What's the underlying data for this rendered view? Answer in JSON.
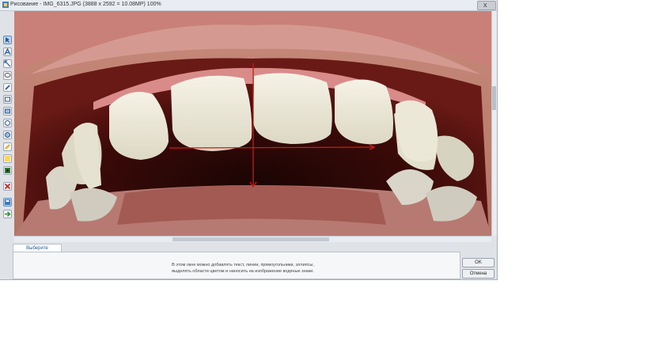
{
  "window": {
    "title": "Рисование - IMG_6315.JPG (3888 x 2592 = 10.08MP) 100%",
    "close_label": "x"
  },
  "toolbar": {
    "tools": [
      {
        "name": "select-tool",
        "icon": "cursor-icon",
        "selected": true
      },
      {
        "name": "text-tool",
        "icon": "text-a-icon"
      },
      {
        "name": "arrow-tool",
        "icon": "arrow-icon"
      },
      {
        "name": "lasso-tool",
        "icon": "lasso-icon"
      },
      {
        "name": "pen-tool",
        "icon": "pen-icon"
      },
      {
        "name": "rectangle-tool",
        "icon": "rectangle-icon"
      },
      {
        "name": "filled-rectangle-tool",
        "icon": "filled-rectangle-icon"
      },
      {
        "name": "ellipse-tool",
        "icon": "ellipse-icon"
      },
      {
        "name": "filled-ellipse-tool",
        "icon": "filled-ellipse-icon"
      },
      {
        "name": "highlighter-tool",
        "icon": "highlighter-icon"
      },
      {
        "name": "color-tool",
        "icon": "color-swatch-icon"
      },
      {
        "name": "watermark-tool",
        "icon": "watermark-icon"
      },
      {
        "name": "delete-tool",
        "icon": "red-x-icon"
      },
      {
        "name": "save-tool",
        "icon": "save-icon"
      },
      {
        "name": "apply-tool",
        "icon": "green-arrow-icon"
      }
    ]
  },
  "panel": {
    "tab_label": "Выберите инструмент",
    "hint_line1": "В этом окне можно добавлять текст, линии, прямоугольники, эллипсы,",
    "hint_line2": "выделять области цветом и наносить на изображение водяные знаки."
  },
  "buttons": {
    "ok": "OK",
    "cancel": "Отмена"
  },
  "colors": {
    "annotation_red": "#d11818",
    "selected_tool": "#bcd6ef"
  }
}
